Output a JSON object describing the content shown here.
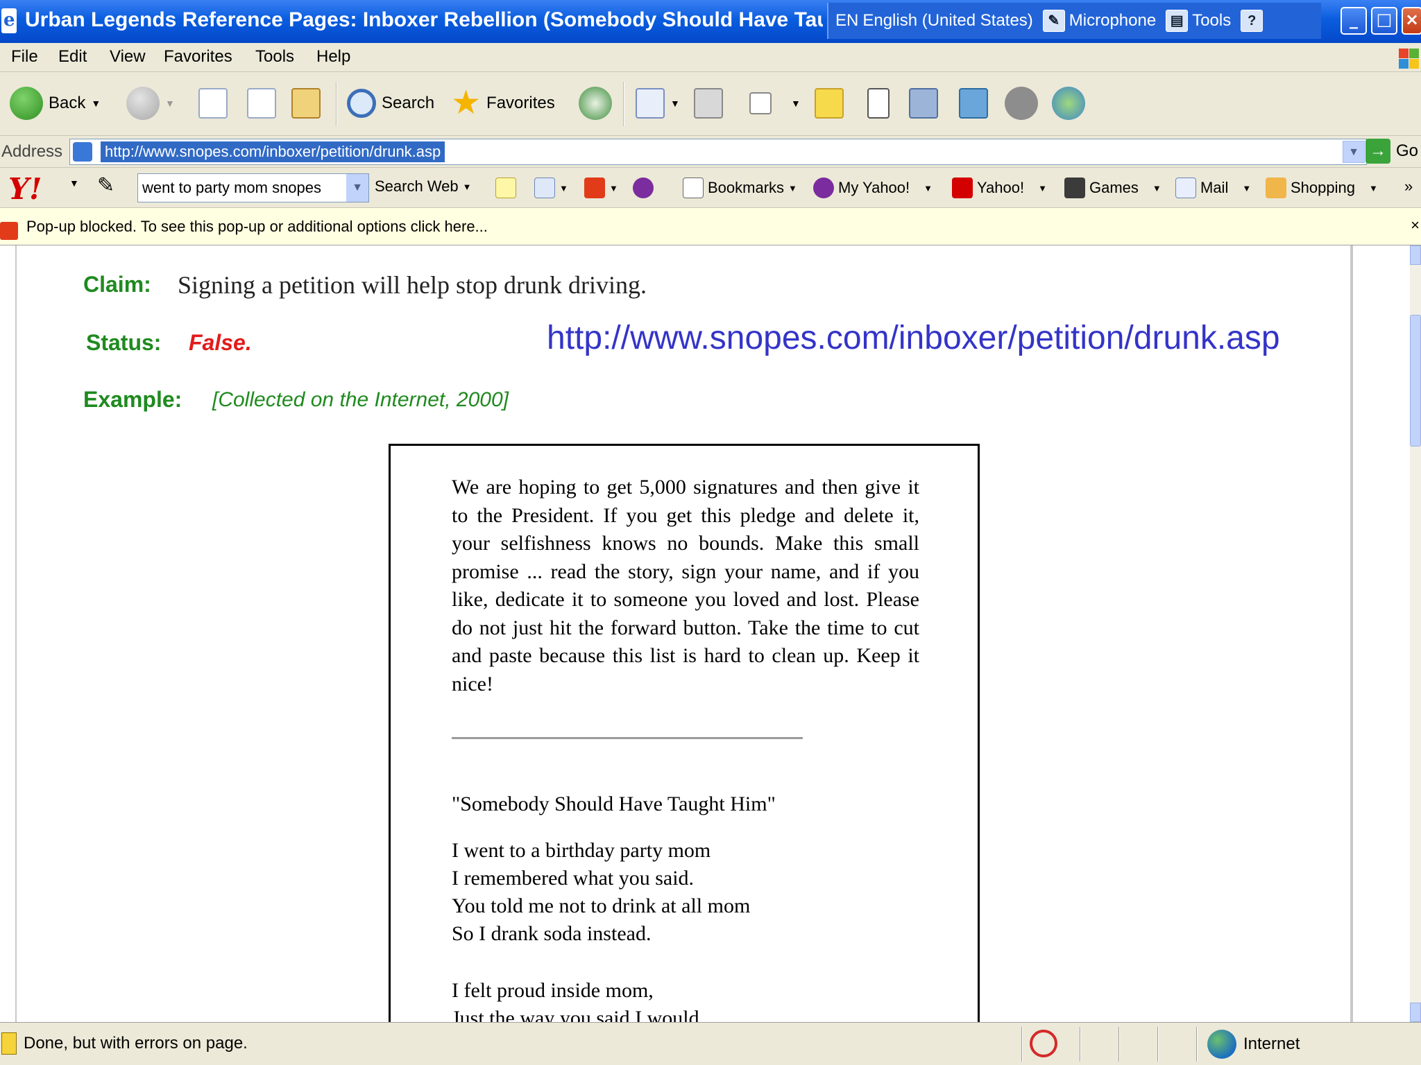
{
  "window": {
    "title": "Urban Legends Reference Pages: Inboxer Rebellion (Somebody Should Have Taught Him)",
    "language_bar": {
      "language": "EN",
      "language_name": "English (United States)",
      "microphone": "Microphone",
      "tools": "Tools",
      "help_glyph": "?"
    }
  },
  "menu": [
    "File",
    "Edit",
    "View",
    "Favorites",
    "Tools",
    "Help"
  ],
  "toolbar": {
    "back": "Back",
    "search": "Search",
    "favorites": "Favorites"
  },
  "address": {
    "label": "Address",
    "url": "http://www.snopes.com/inboxer/petition/drunk.asp",
    "go": "Go"
  },
  "yahoo": {
    "logo": "Y!",
    "search_value": "went to party mom snopes",
    "search_web": "Search Web",
    "bookmarks": "Bookmarks",
    "my_yahoo": "My Yahoo!",
    "yahoo": "Yahoo!",
    "games": "Games",
    "mail": "Mail",
    "shopping": "Shopping"
  },
  "infobar": {
    "message": "Pop-up blocked. To see this pop-up or additional options click here..."
  },
  "page": {
    "claim_label": "Claim:",
    "claim_text": "Signing a petition will help stop drunk driving.",
    "status_label": "Status:",
    "status_text": "False.",
    "example_label": "Example:",
    "example_text": "[Collected on the Internet, 2000]",
    "url_overlay": "http://www.snopes.com/inboxer/petition/drunk.asp",
    "email_body": "We are hoping to get 5,000 signatures and then give it to the President. If you get this pledge and delete it, your selfishness knows no bounds. Make this small promise ... read the story, sign your name, and if you like, dedicate it to someone you loved and lost. Please do not just hit the forward button. Take the time to cut and paste because this list is hard to clean up. Keep it nice!",
    "poem_title": "\"Somebody Should Have Taught Him\"",
    "poem_lines": [
      "I went to a birthday party mom",
      "I remembered what you said.",
      "You told me not to drink at all mom",
      "So I drank soda instead.",
      "",
      "I felt proud inside mom,",
      "Just the way you said I would"
    ]
  },
  "statusbar": {
    "text": "Done, but with errors on page.",
    "zone": "Internet"
  },
  "colors": {
    "titlebar": "#0a5ddf",
    "label_green": "#1f8a1f",
    "status_red": "#e21b1b",
    "url_blue": "#3434c8",
    "selection": "#316ac5"
  }
}
